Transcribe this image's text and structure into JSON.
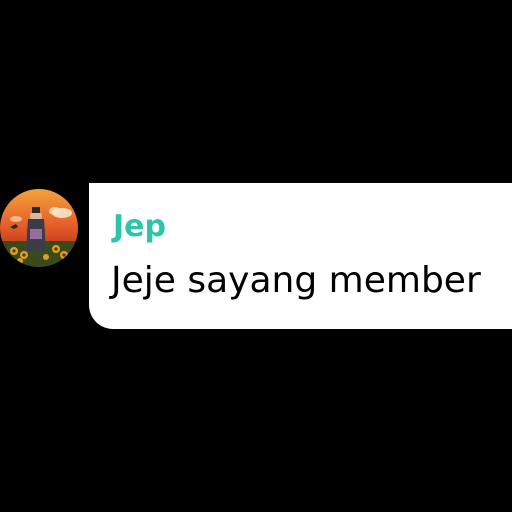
{
  "message": {
    "sender_name": "Jep",
    "text": "Jeje sayang member",
    "sender_color": "#2ec4a8",
    "bubble_color": "#ffffff",
    "avatar_icon": "profile-picture"
  }
}
